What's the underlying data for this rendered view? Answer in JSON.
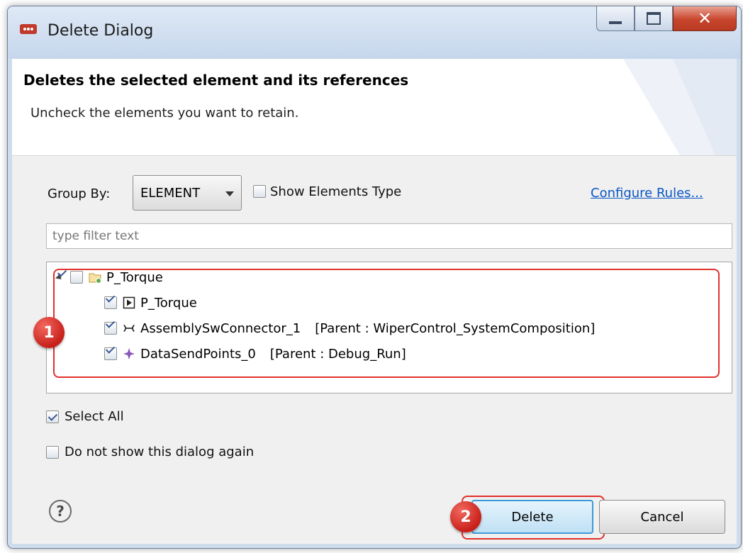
{
  "window": {
    "title": "Delete Dialog"
  },
  "header": {
    "title": "Deletes the selected element and its references",
    "description": "Uncheck the elements you want to retain."
  },
  "options": {
    "group_by_label": "Group By:",
    "group_by_value": "ELEMENT",
    "show_types_label": "Show Elements Type",
    "show_types_checked": false,
    "configure_link": "Configure Rules..."
  },
  "filter": {
    "placeholder": "type filter text",
    "value": ""
  },
  "tree": {
    "items": [
      {
        "label": "P_Torque",
        "parent": "",
        "checked": true,
        "expanded": true,
        "icon": "package-folder-icon"
      },
      {
        "label": "P_Torque",
        "parent": "",
        "checked": true,
        "icon": "port-icon"
      },
      {
        "label": "AssemblySwConnector_1",
        "parent": "[Parent : WiperControl_SystemComposition]",
        "checked": true,
        "icon": "connector-icon"
      },
      {
        "label": "DataSendPoints_0",
        "parent": "[Parent : Debug_Run]",
        "checked": true,
        "icon": "data-point-icon"
      }
    ]
  },
  "footer": {
    "select_all_label": "Select All",
    "select_all_checked": true,
    "do_not_show_label": "Do not show this dialog again",
    "do_not_show_checked": false,
    "help_icon": "question-mark-icon",
    "delete_label": "Delete",
    "cancel_label": "Cancel"
  },
  "annotations": {
    "badge1": "1",
    "badge2": "2",
    "highlight_color": "#e0312c"
  },
  "colors": {
    "link": "#0b56c4",
    "titlebar": "#c5d6ec",
    "close_button": "#c8452d"
  }
}
